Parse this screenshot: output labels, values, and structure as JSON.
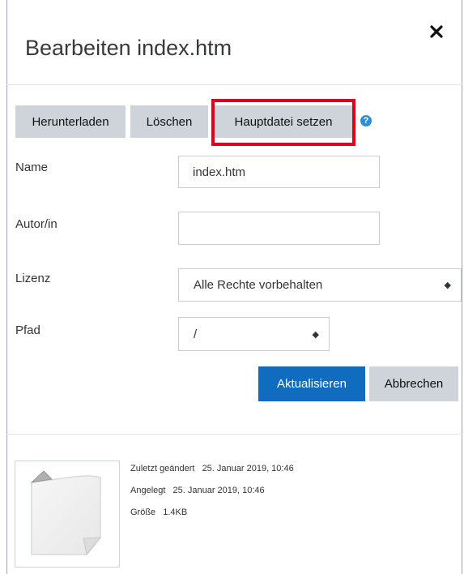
{
  "dialog": {
    "title": "Bearbeiten index.htm",
    "close_icon": "close-icon"
  },
  "toolbar": {
    "download_label": "Herunterladen",
    "delete_label": "Löschen",
    "set_main_label": "Hauptdatei setzen",
    "help_icon": "question-circle-icon",
    "help_glyph": "?"
  },
  "form": {
    "name_label": "Name",
    "name_value": "index.htm",
    "author_label": "Autor/in",
    "author_value": "",
    "license_label": "Lizenz",
    "license_value": "Alle Rechte vorbehalten",
    "path_label": "Pfad",
    "path_value": "/",
    "select_icon": "up-down-arrows-icon",
    "select_glyph": "◆"
  },
  "actions": {
    "update_label": "Aktualisieren",
    "cancel_label": "Abbrechen"
  },
  "file_info": {
    "modified_label": "Zuletzt geändert",
    "modified_value": "25. Januar 2019, 10:46",
    "created_label": "Angelegt",
    "created_value": "25. Januar 2019, 10:46",
    "size_label": "Größe",
    "size_value": "1.4KB",
    "thumbnail_icon": "file-icon"
  },
  "colors": {
    "primary": "#0f6cbf",
    "highlight": "#e3001b",
    "help": "#2e8fd6"
  }
}
